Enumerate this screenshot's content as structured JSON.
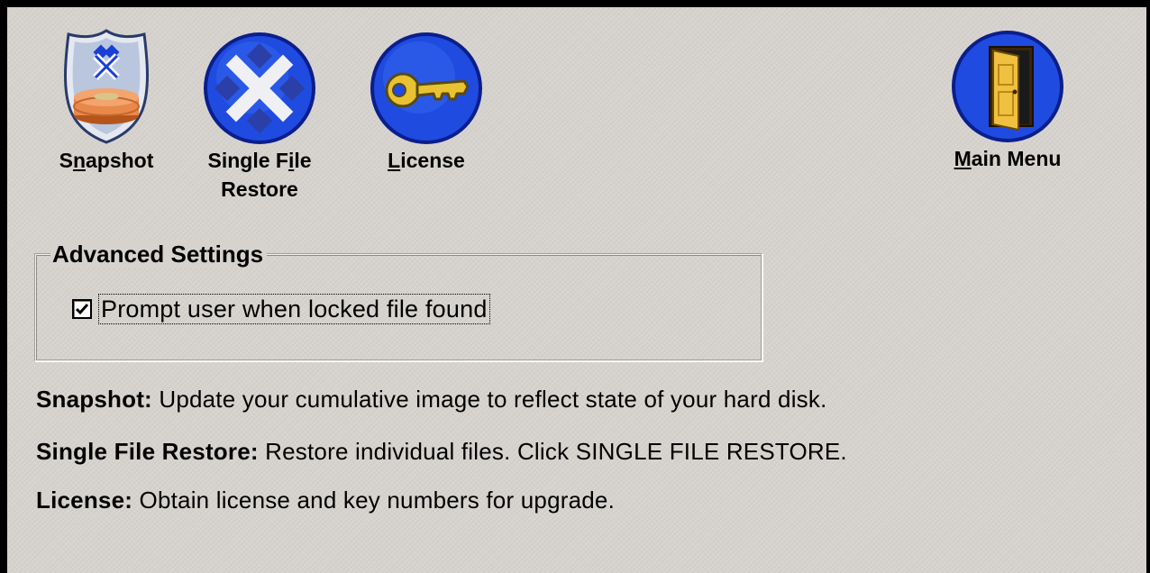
{
  "toolbar": {
    "snapshot": {
      "label_pre": "S",
      "label_mnemonic": "n",
      "label_post": "apshot",
      "icon": "shield-disk-icon"
    },
    "single_file_restore": {
      "line1_pre": "Single F",
      "line1_mnemonic": "i",
      "line1_post": "le",
      "line2": "Restore",
      "icon": "blue-x-icon"
    },
    "license": {
      "label_mnemonic": "L",
      "label_post": "icense",
      "icon": "key-icon"
    },
    "main_menu": {
      "label_mnemonic": "M",
      "label_post": "ain Menu",
      "icon": "door-icon"
    }
  },
  "advanced_settings": {
    "title": "Advanced Settings",
    "prompt_locked": {
      "label": "Prompt user when locked file found",
      "checked": true
    }
  },
  "descriptions": {
    "snapshot": {
      "term": "Snapshot:",
      "text": "Update your cumulative image to reflect state of your hard disk."
    },
    "single_file_restore": {
      "term": "Single File Restore:",
      "text": "Restore individual files. Click SINGLE FILE RESTORE."
    },
    "license": {
      "term": "License:",
      "text": "Obtain license and key numbers for upgrade."
    }
  },
  "colors": {
    "background": "#d6d3ce",
    "icon_blue": "#1a3fd6",
    "key_gold": "#e8c232",
    "disk_orange": "#e8884a"
  }
}
